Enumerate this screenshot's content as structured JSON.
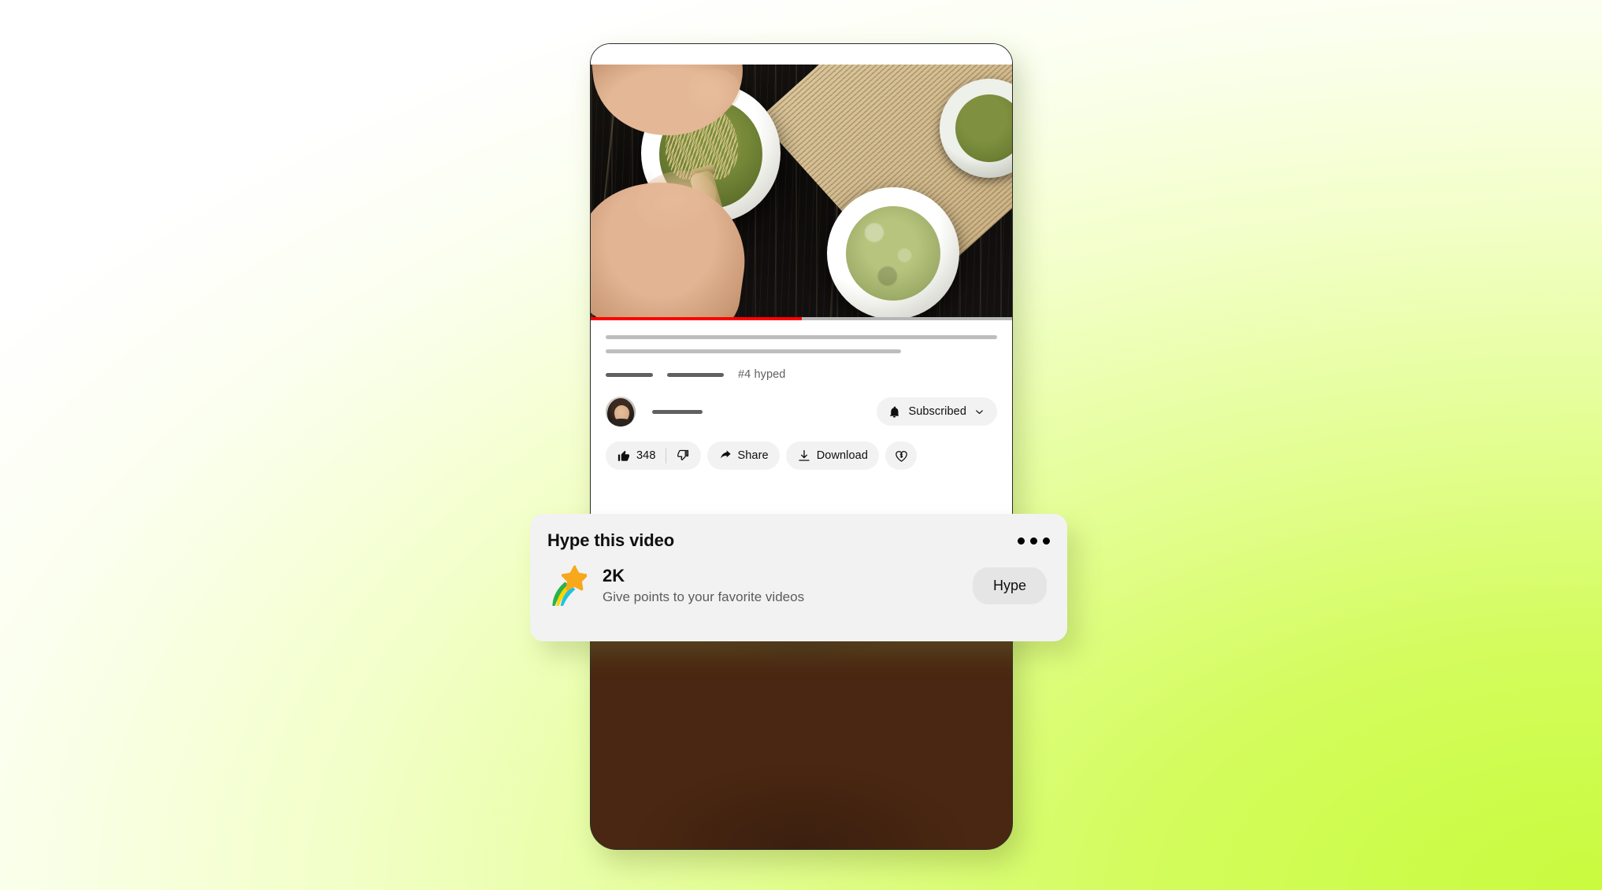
{
  "background": {
    "gradient_from": "#FFFFFF",
    "gradient_to": "#C9FB3E"
  },
  "phone": {
    "player": {
      "scene": "matcha-preparation",
      "progress_percent": 50,
      "progress_color": "#FF0000",
      "track_color": "#B6B6B6"
    },
    "video_meta": {
      "title_skeleton_lines": 2,
      "hyped_rank": "#4 hyped",
      "channel_name_skeleton": true
    },
    "subscribe": {
      "label": "Subscribed",
      "bell_icon": "bell-icon",
      "chevron_icon": "chevron-down-icon"
    },
    "actions": [
      {
        "name": "like",
        "icon": "thumbs-up-icon",
        "label": "348"
      },
      {
        "name": "dislike",
        "icon": "thumbs-down-icon",
        "label": ""
      },
      {
        "name": "share",
        "icon": "share-arrow-icon",
        "label": "Share"
      },
      {
        "name": "download",
        "icon": "download-icon",
        "label": "Download"
      },
      {
        "name": "thanks",
        "icon": "heart-dollar-icon",
        "label": ""
      }
    ],
    "next_video": {
      "scene": "coffee-beans"
    }
  },
  "hype_card": {
    "title": "Hype this video",
    "menu_icon": "more-horizontal-icon",
    "star_icon": "shooting-star-icon",
    "amount": "2K",
    "subtitle": "Give points to your favorite videos",
    "button_label": "Hype",
    "background_color": "#F2F2F2",
    "button_color": "#E5E5E5"
  }
}
